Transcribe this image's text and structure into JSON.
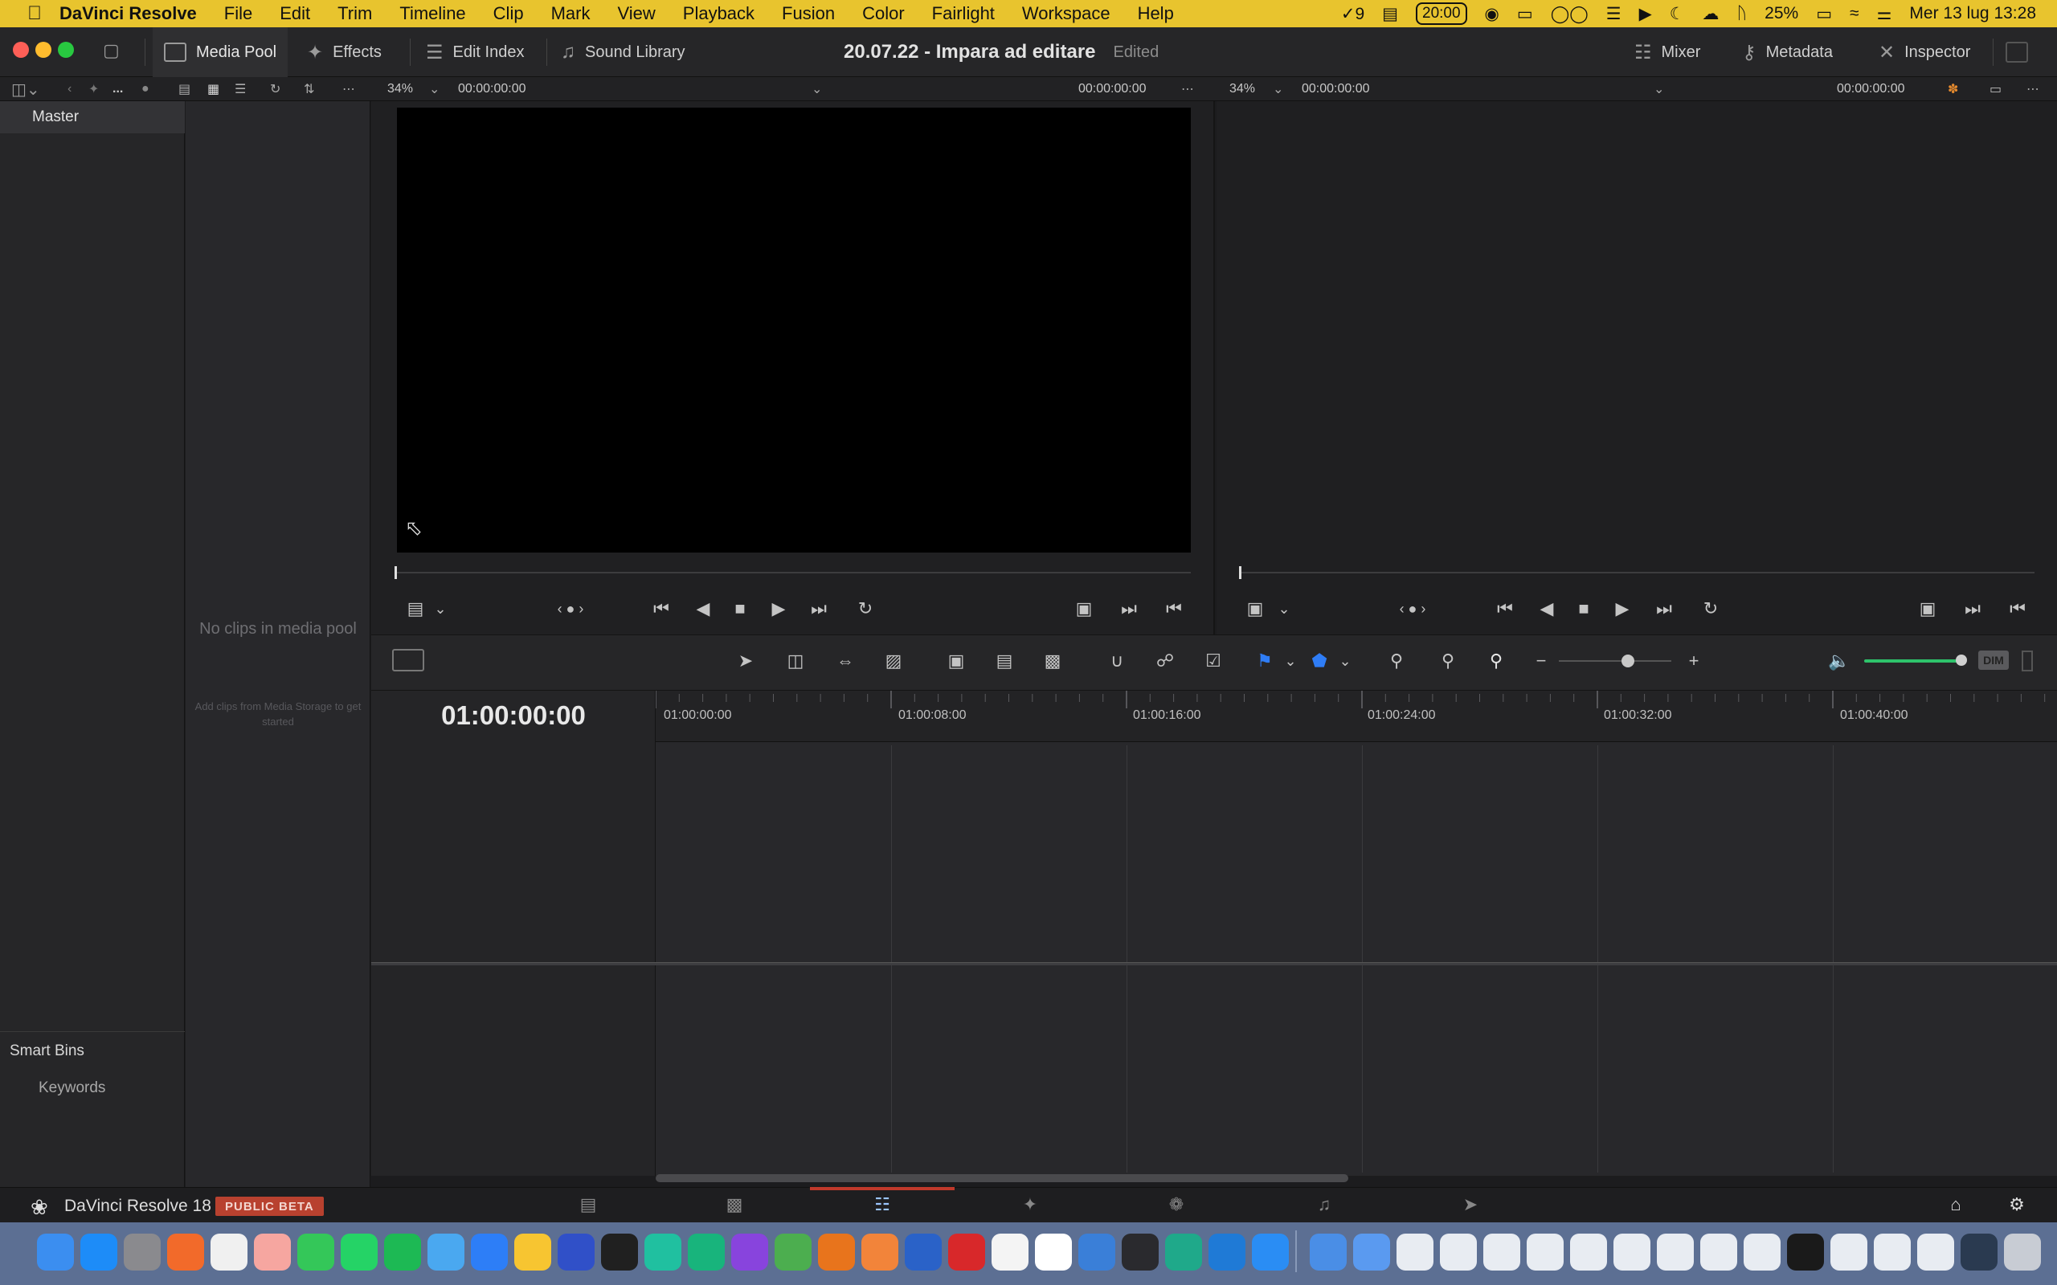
{
  "menubar": {
    "apple_icon": "apple-logo-icon",
    "app_name": "DaVinci Resolve",
    "menus": [
      "File",
      "Edit",
      "Trim",
      "Timeline",
      "Clip",
      "Mark",
      "View",
      "Playback",
      "Fusion",
      "Color",
      "Fairlight",
      "Workspace",
      "Help"
    ],
    "status_badge_count": "9",
    "status_time_pill": "20:00",
    "battery": "25%",
    "clock": "Mer 13 lug  13:28"
  },
  "toolbar": {
    "media_pool": "Media Pool",
    "effects": "Effects",
    "edit_index": "Edit Index",
    "sound_library": "Sound Library",
    "project_title": "20.07.22 - Impara ad editare",
    "project_status": "Edited",
    "mixer": "Mixer",
    "metadata": "Metadata",
    "inspector": "Inspector"
  },
  "viewer_header": {
    "more": "...",
    "source_zoom": "34%",
    "source_tc_left": "00:00:00:00",
    "source_tc_right": "00:00:00:00",
    "program_zoom": "34%",
    "program_tc_left": "00:00:00:00",
    "program_tc_right": "00:00:00:00"
  },
  "bins": {
    "master": "Master",
    "smart_bins": "Smart Bins",
    "keywords": "Keywords"
  },
  "media_pool": {
    "empty_title": "No clips in media pool",
    "empty_hint": "Add clips from Media Storage to get started"
  },
  "timeline": {
    "timecode": "01:00:00:00",
    "ruler_labels": [
      "01:00:00:00",
      "01:00:08:00",
      "01:00:16:00",
      "01:00:24:00",
      "01:00:32:00",
      "01:00:40:00"
    ],
    "dim_label": "DIM"
  },
  "pagebar": {
    "app_title": "DaVinci Resolve 18",
    "badge": "PUBLIC BETA"
  },
  "colors": {
    "menubar_bg": "#e8c42e",
    "active_page_accent": "#c0392b",
    "flag_blue": "#2f7df6",
    "volume_green": "#2ec36b"
  }
}
